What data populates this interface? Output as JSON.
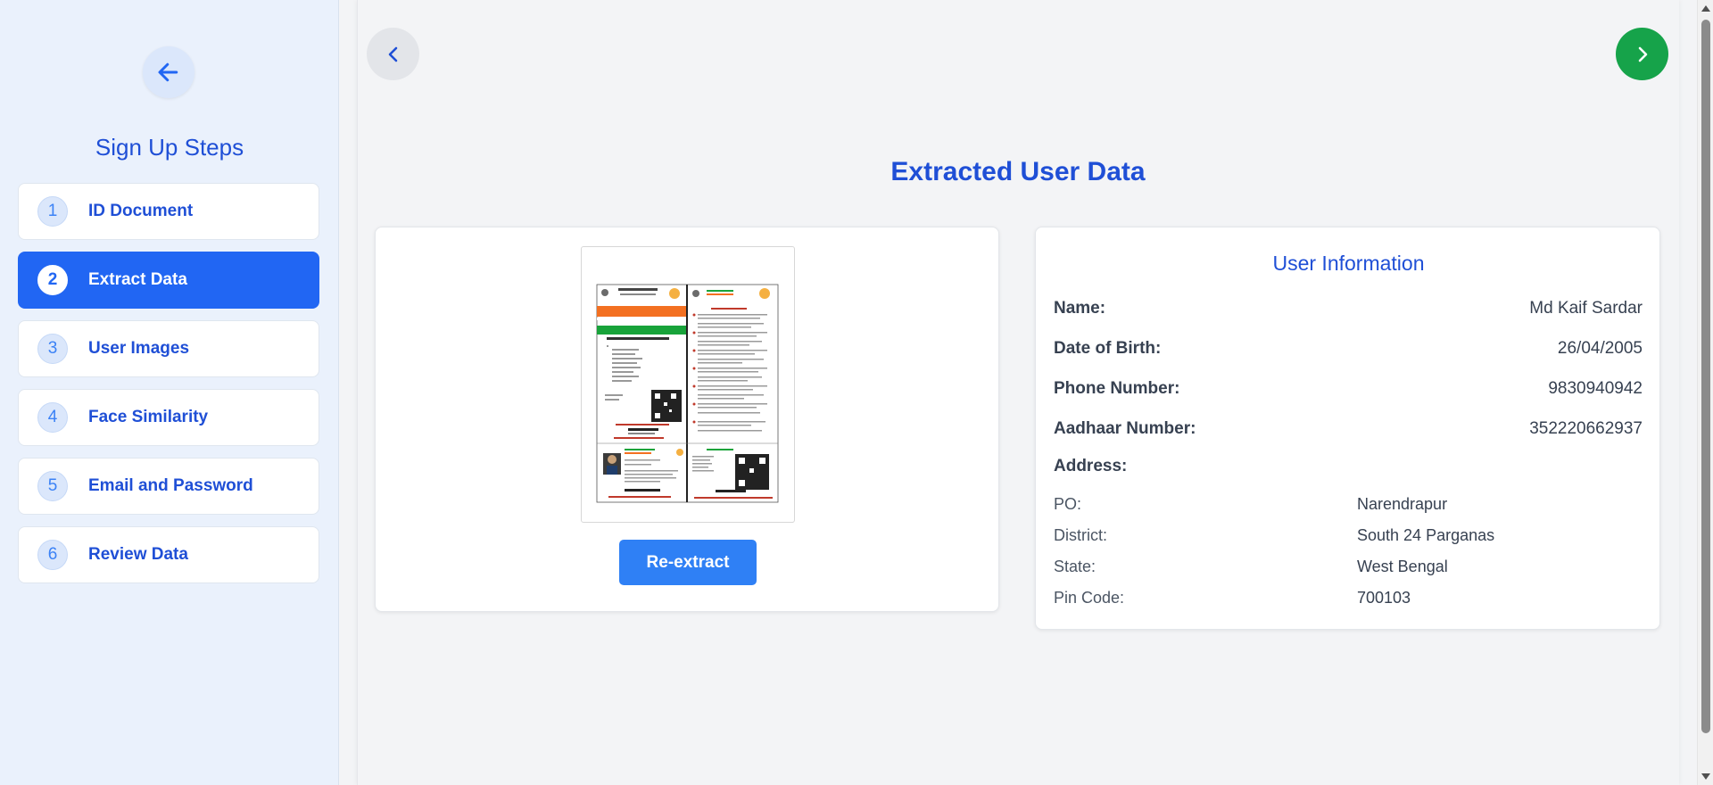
{
  "sidebar": {
    "title": "Sign Up Steps",
    "steps": [
      {
        "number": "1",
        "label": "ID Document",
        "active": false
      },
      {
        "number": "2",
        "label": "Extract Data",
        "active": true
      },
      {
        "number": "3",
        "label": "User Images",
        "active": false
      },
      {
        "number": "4",
        "label": "Face Similarity",
        "active": false
      },
      {
        "number": "5",
        "label": "Email and Password",
        "active": false
      },
      {
        "number": "6",
        "label": "Review Data",
        "active": false
      }
    ]
  },
  "icons": {
    "sidebar_back": "arrow-left-icon",
    "prev": "chevron-left-icon",
    "next": "chevron-right-icon"
  },
  "colors": {
    "accent": "#2166f3",
    "heading": "#1f4fd6",
    "next_button": "#16a34a"
  },
  "main": {
    "title": "Extracted User Data",
    "reextract_label": "Re-extract"
  },
  "user_info": {
    "title": "User Information",
    "name_label": "Name:",
    "name": "Md Kaif Sardar",
    "dob_label": "Date of Birth:",
    "dob": "26/04/2005",
    "phone_label": "Phone Number:",
    "phone": "9830940942",
    "aadhaar_label": "Aadhaar Number:",
    "aadhaar": "352220662937",
    "address_label": "Address:",
    "address": {
      "po_label": "PO:",
      "po": "Narendrapur",
      "district_label": "District:",
      "district": "South 24 Parganas",
      "state_label": "State:",
      "state": "West Bengal",
      "pin_label": "Pin Code:",
      "pin": "700103"
    }
  }
}
